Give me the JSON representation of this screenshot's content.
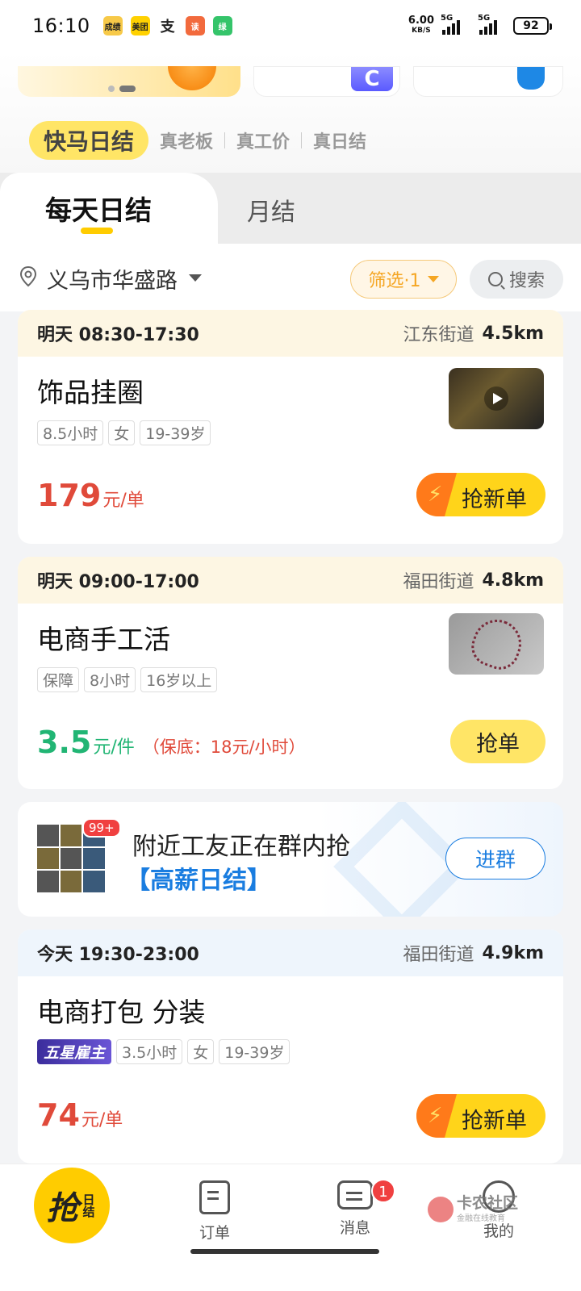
{
  "status_bar": {
    "time": "16:10",
    "apps": [
      "成绩",
      "美团",
      "支",
      "读",
      "绿"
    ],
    "net_speed": "6.00",
    "net_unit": "KB/S",
    "sig1": "5G",
    "sig2": "5G",
    "battery": "92"
  },
  "slogans": {
    "main": "快马日结",
    "items": [
      "真老板",
      "真工价",
      "真日结"
    ]
  },
  "tabs": {
    "active": "每天日结",
    "other": "月结"
  },
  "filter_bar": {
    "location": "义乌市华盛路",
    "filter_label": "筛选·1",
    "search_label": "搜索"
  },
  "jobs": [
    {
      "time": "明天 08:30-17:30",
      "street": "江东街道",
      "distance": "4.5km",
      "title": "饰品挂圈",
      "tags": [
        "8.5小时",
        "女",
        "19-39岁"
      ],
      "price": "179",
      "unit": "元/单",
      "button": "抢新单"
    },
    {
      "time": "明天 09:00-17:00",
      "street": "福田街道",
      "distance": "4.8km",
      "title": "电商手工活",
      "tags": [
        "保障",
        "8小时",
        "16岁以上"
      ],
      "price": "3.5",
      "unit": "元/件",
      "note": "（保底：18元/小时）",
      "button": "抢单"
    },
    {
      "time": "今天 19:30-23:00",
      "street": "福田街道",
      "distance": "4.9km",
      "title": "电商打包 分装",
      "star_tag": "五星雇主",
      "tags": [
        "3.5小时",
        "女",
        "19-39岁"
      ],
      "price": "74",
      "unit": "元/单",
      "button": "抢新单"
    }
  ],
  "group_banner": {
    "badge": "99+",
    "line1": "附近工友正在群内抢",
    "line2": "【高薪日结】",
    "button": "进群"
  },
  "bottom_nav": {
    "fab_big": "抢",
    "fab_small": "日结",
    "items": [
      {
        "label": "订单"
      },
      {
        "label": "消息",
        "badge": "1"
      },
      {
        "label": "我的"
      }
    ],
    "watermark_title": "卡农社区",
    "watermark_sub": "金融在线教育"
  },
  "colors": {
    "accent_yellow": "#ffcc00",
    "price_red": "#e04a3a",
    "price_green": "#21b574",
    "link_blue": "#1a7de0"
  }
}
